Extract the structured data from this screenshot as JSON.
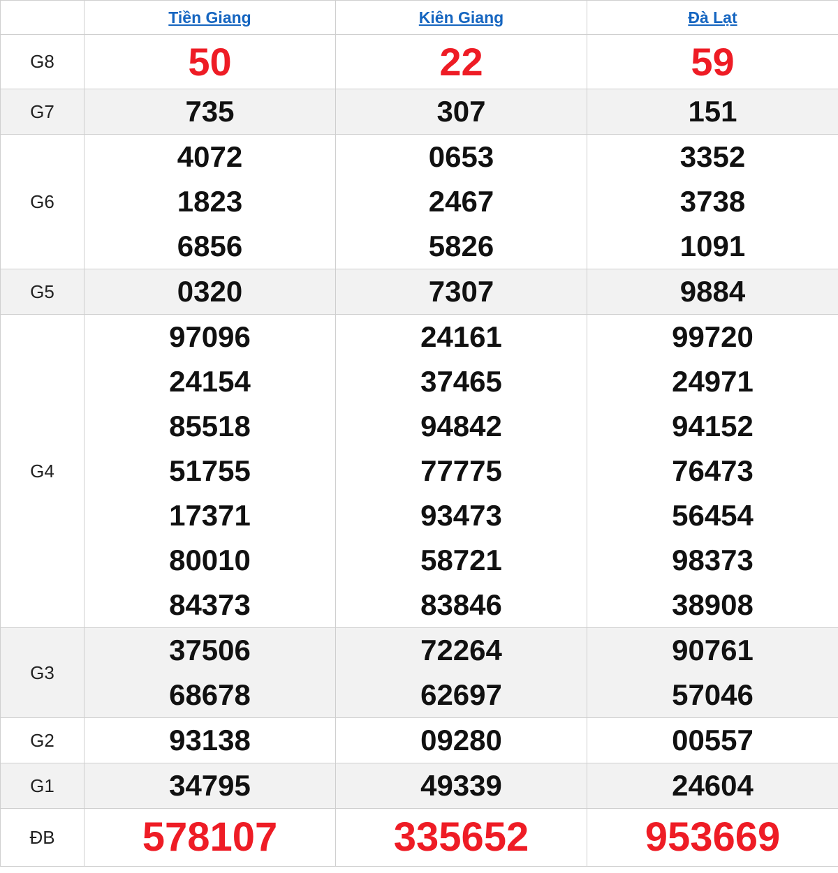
{
  "provinces": [
    "Tiền Giang",
    "Kiên Giang",
    "Đà Lạt"
  ],
  "colors": {
    "accent_red": "#ee1c25",
    "link_blue": "#1565c0",
    "alt_row": "#f2f2f2"
  },
  "prizes": [
    {
      "label": "G8",
      "values": [
        [
          "50"
        ],
        [
          "22"
        ],
        [
          "59"
        ]
      ]
    },
    {
      "label": "G7",
      "values": [
        [
          "735"
        ],
        [
          "307"
        ],
        [
          "151"
        ]
      ]
    },
    {
      "label": "G6",
      "values": [
        [
          "4072",
          "1823",
          "6856"
        ],
        [
          "0653",
          "2467",
          "5826"
        ],
        [
          "3352",
          "3738",
          "1091"
        ]
      ]
    },
    {
      "label": "G5",
      "values": [
        [
          "0320"
        ],
        [
          "7307"
        ],
        [
          "9884"
        ]
      ]
    },
    {
      "label": "G4",
      "values": [
        [
          "97096",
          "24154",
          "85518",
          "51755",
          "17371",
          "80010",
          "84373"
        ],
        [
          "24161",
          "37465",
          "94842",
          "77775",
          "93473",
          "58721",
          "83846"
        ],
        [
          "99720",
          "24971",
          "94152",
          "76473",
          "56454",
          "98373",
          "38908"
        ]
      ]
    },
    {
      "label": "G3",
      "values": [
        [
          "37506",
          "68678"
        ],
        [
          "72264",
          "62697"
        ],
        [
          "90761",
          "57046"
        ]
      ]
    },
    {
      "label": "G2",
      "values": [
        [
          "93138"
        ],
        [
          "09280"
        ],
        [
          "00557"
        ]
      ]
    },
    {
      "label": "G1",
      "values": [
        [
          "34795"
        ],
        [
          "49339"
        ],
        [
          "24604"
        ]
      ]
    },
    {
      "label": "ĐB",
      "values": [
        [
          "578107"
        ],
        [
          "335652"
        ],
        [
          "953669"
        ]
      ]
    }
  ]
}
